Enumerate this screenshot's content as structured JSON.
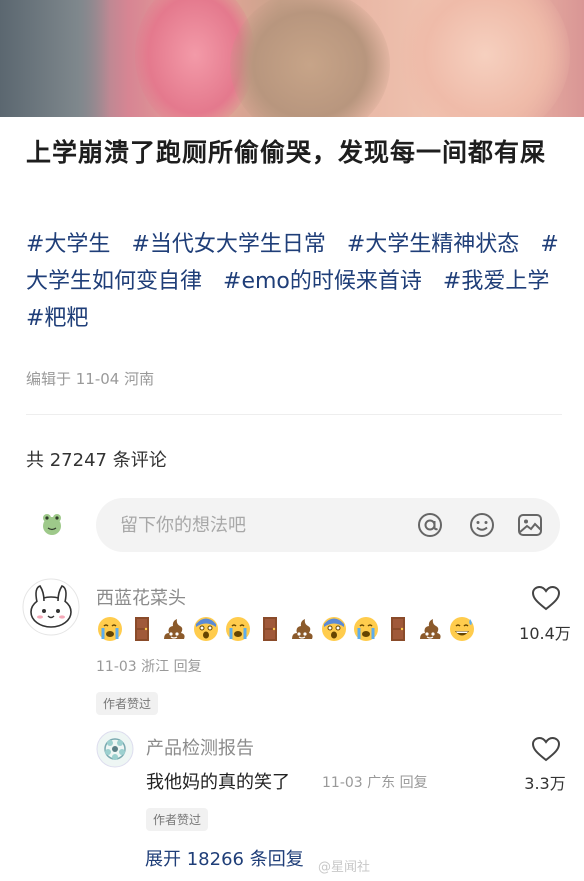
{
  "post": {
    "title": "上学崩溃了跑厕所偷偷哭，发现每一间都有屎",
    "tags": [
      "#大学生",
      "#当代女大学生日常",
      "#大学生精神状态",
      "#大学生如何变自律",
      "#emo的时候来首诗",
      "#我爱上学",
      "#粑粑"
    ],
    "meta": "编辑于 11-04 河南"
  },
  "comments_section": {
    "count_label": "共 27247 条评论",
    "input_placeholder": "留下你的想法吧",
    "input_icons": [
      "at-icon",
      "emoji-icon",
      "image-icon"
    ]
  },
  "comments": [
    {
      "name": "西蓝花菜头",
      "emojis": [
        "crying-face",
        "door",
        "poop",
        "scared-face",
        "crying-face",
        "door",
        "poop",
        "scared-face",
        "crying-face",
        "door",
        "poop",
        "grinning-sweat-face"
      ],
      "meta": "11-03 浙江  回复",
      "badge": "作者赞过",
      "likes": "10.4万"
    },
    {
      "name": "产品检测报告",
      "text": "我他妈的真的笑了",
      "meta": "11-03 广东  回复",
      "badge": "作者赞过",
      "likes": "3.3万"
    }
  ],
  "expand_label": "展开 18266 条回复",
  "watermark": "@星闻社"
}
